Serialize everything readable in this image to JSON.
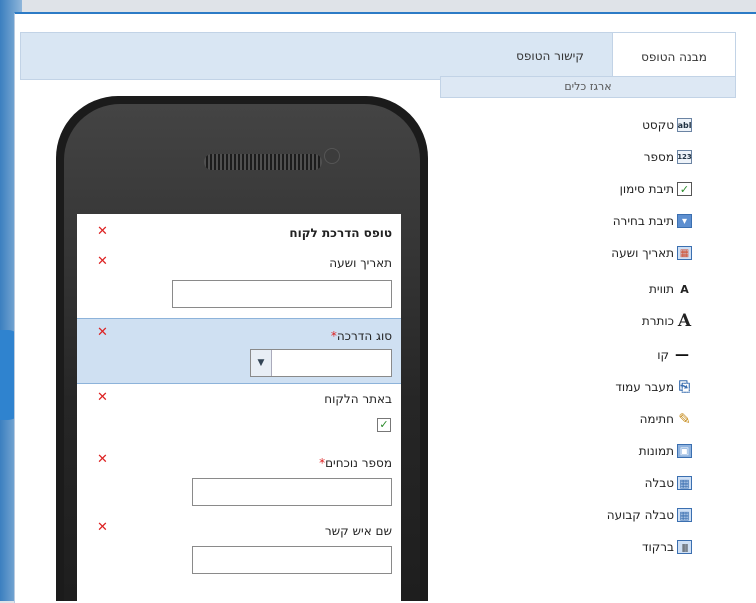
{
  "tabs": {
    "active": "מבנה הטופס",
    "second": "קישור הטופס"
  },
  "toolbox": {
    "title": "ארגז כלים",
    "items": [
      {
        "label": "טקסט",
        "icon": "text-field-icon",
        "glyph": "abl"
      },
      {
        "label": "מספר",
        "icon": "number-field-icon",
        "glyph": "123"
      },
      {
        "label": "תיבת סימון",
        "icon": "checkbox-icon",
        "glyph": "✓"
      },
      {
        "label": "תיבת בחירה",
        "icon": "dropdown-icon",
        "glyph": "▾"
      },
      {
        "label": "תאריך ושעה",
        "icon": "calendar-icon",
        "glyph": "▦"
      },
      {
        "label": "תווית",
        "icon": "label-icon",
        "glyph": "A"
      },
      {
        "label": "כותרת",
        "icon": "heading-icon",
        "glyph": "A"
      },
      {
        "label": "קו",
        "icon": "line-icon",
        "glyph": "—"
      },
      {
        "label": "מעבר עמוד",
        "icon": "page-break-icon",
        "glyph": "⎘"
      },
      {
        "label": "חתימה",
        "icon": "signature-icon",
        "glyph": "✎"
      },
      {
        "label": "תמונות",
        "icon": "image-icon",
        "glyph": "▣"
      },
      {
        "label": "טבלה",
        "icon": "table-icon",
        "glyph": "▦"
      },
      {
        "label": "טבלה קבועה",
        "icon": "fixed-table-icon",
        "glyph": "▦"
      },
      {
        "label": "ברקוד",
        "icon": "barcode-icon",
        "glyph": "|||"
      }
    ]
  },
  "form": {
    "title": "טופס הדרכת לקוח",
    "fields": [
      {
        "label": "תאריך ושעה",
        "value": ""
      },
      {
        "label": "סוג הדרכה",
        "required": "*",
        "value": ""
      },
      {
        "label": "באתר הלקוח",
        "checked": "✓"
      },
      {
        "label": "מספר נוכחים",
        "required": "*",
        "value": ""
      },
      {
        "label": "שם איש קשר",
        "value": ""
      }
    ],
    "delete_glyph": "✕"
  },
  "colors": {
    "accent": "#2c7bc6",
    "selection": "#cfe0f2",
    "delete": "#dd2222",
    "check": "#2a8a2a"
  }
}
